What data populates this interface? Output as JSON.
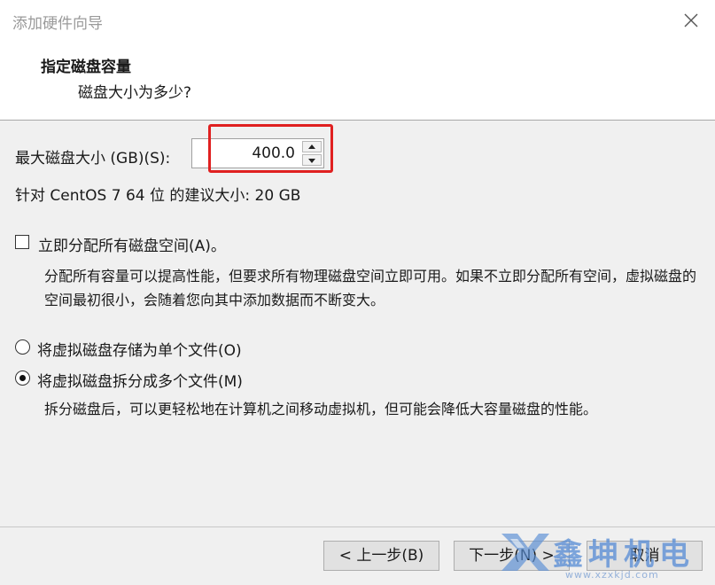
{
  "window": {
    "title": "添加硬件向导"
  },
  "header": {
    "title": "指定磁盘容量",
    "subtitle": "磁盘大小为多少?"
  },
  "disk_size": {
    "label": "最大磁盘大小 (GB)(S):",
    "value": "400.0",
    "recommendation": "针对 CentOS 7 64 位 的建议大小: 20 GB"
  },
  "allocate": {
    "label": "立即分配所有磁盘空间(A)。",
    "checked": false,
    "description": "分配所有容量可以提高性能，但要求所有物理磁盘空间立即可用。如果不立即分配所有空间，虚拟磁盘的空间最初很小，会随着您向其中添加数据而不断变大。"
  },
  "storage_options": [
    {
      "label": "将虚拟磁盘存储为单个文件(O)",
      "selected": false
    },
    {
      "label": "将虚拟磁盘拆分成多个文件(M)",
      "selected": true
    }
  ],
  "split_description": "拆分磁盘后，可以更轻松地在计算机之间移动虚拟机，但可能会降低大容量磁盘的性能。",
  "buttons": {
    "back": "< 上一步(B)",
    "next": "下一步(N) >",
    "cancel": "取消"
  },
  "watermark": {
    "text": "鑫坤机电",
    "url": "www.xzxkjd.com"
  },
  "colors": {
    "highlight": "#e02020",
    "watermark": "#5b8fd6"
  }
}
